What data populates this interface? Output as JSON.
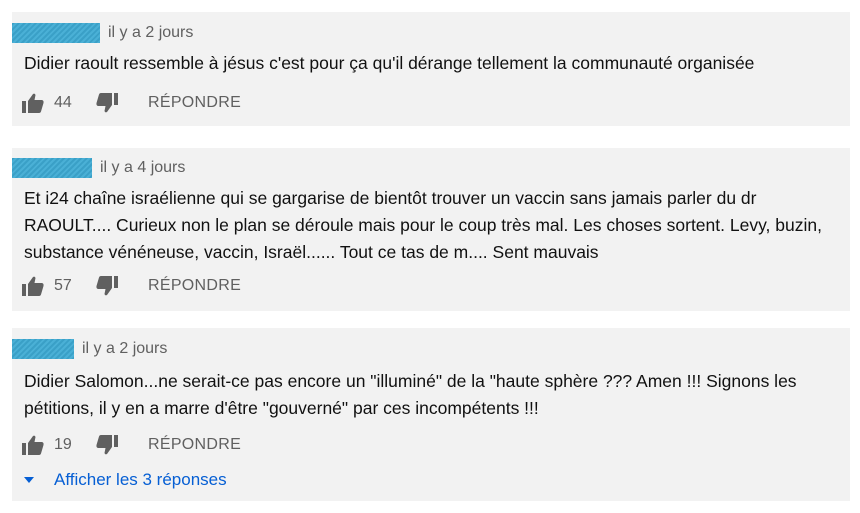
{
  "comments": [
    {
      "time": "il y a 2 jours",
      "text": "Didier raoult ressemble à jésus c'est pour ça qu'il dérange tellement la communauté organisée",
      "likes": "44",
      "reply_label": "RÉPONDRE"
    },
    {
      "time": "il y a 4 jours",
      "text": "Et i24 chaîne israélienne qui se gargarise de bientôt trouver un vaccin sans jamais parler du dr RAOULT.... Curieux  non le plan se déroule mais pour le coup très mal. Les choses sortent. Levy, buzin, substance vénéneuse, vaccin, Israël...... Tout ce tas de m.... Sent mauvais",
      "likes": "57",
      "reply_label": "RÉPONDRE"
    },
    {
      "time": "il y a 2 jours",
      "text": "Didier Salomon...ne serait-ce pas encore un \"illuminé\" de la \"haute sphère ??? Amen !!! Signons les pétitions, il y en a marre d'être \"gouverné\" par ces incompétents !!!",
      "likes": "19",
      "reply_label": "RÉPONDRE",
      "show_replies_label": "Afficher les 3 réponses"
    }
  ],
  "icons": {
    "like": "thumb-up-icon",
    "dislike": "thumb-down-icon",
    "expand": "caret-down-icon"
  },
  "colors": {
    "card_bg": "#f2f2f2",
    "meta_text": "#606060",
    "link_blue": "#065fd4",
    "redaction": "#3aa0c7"
  }
}
